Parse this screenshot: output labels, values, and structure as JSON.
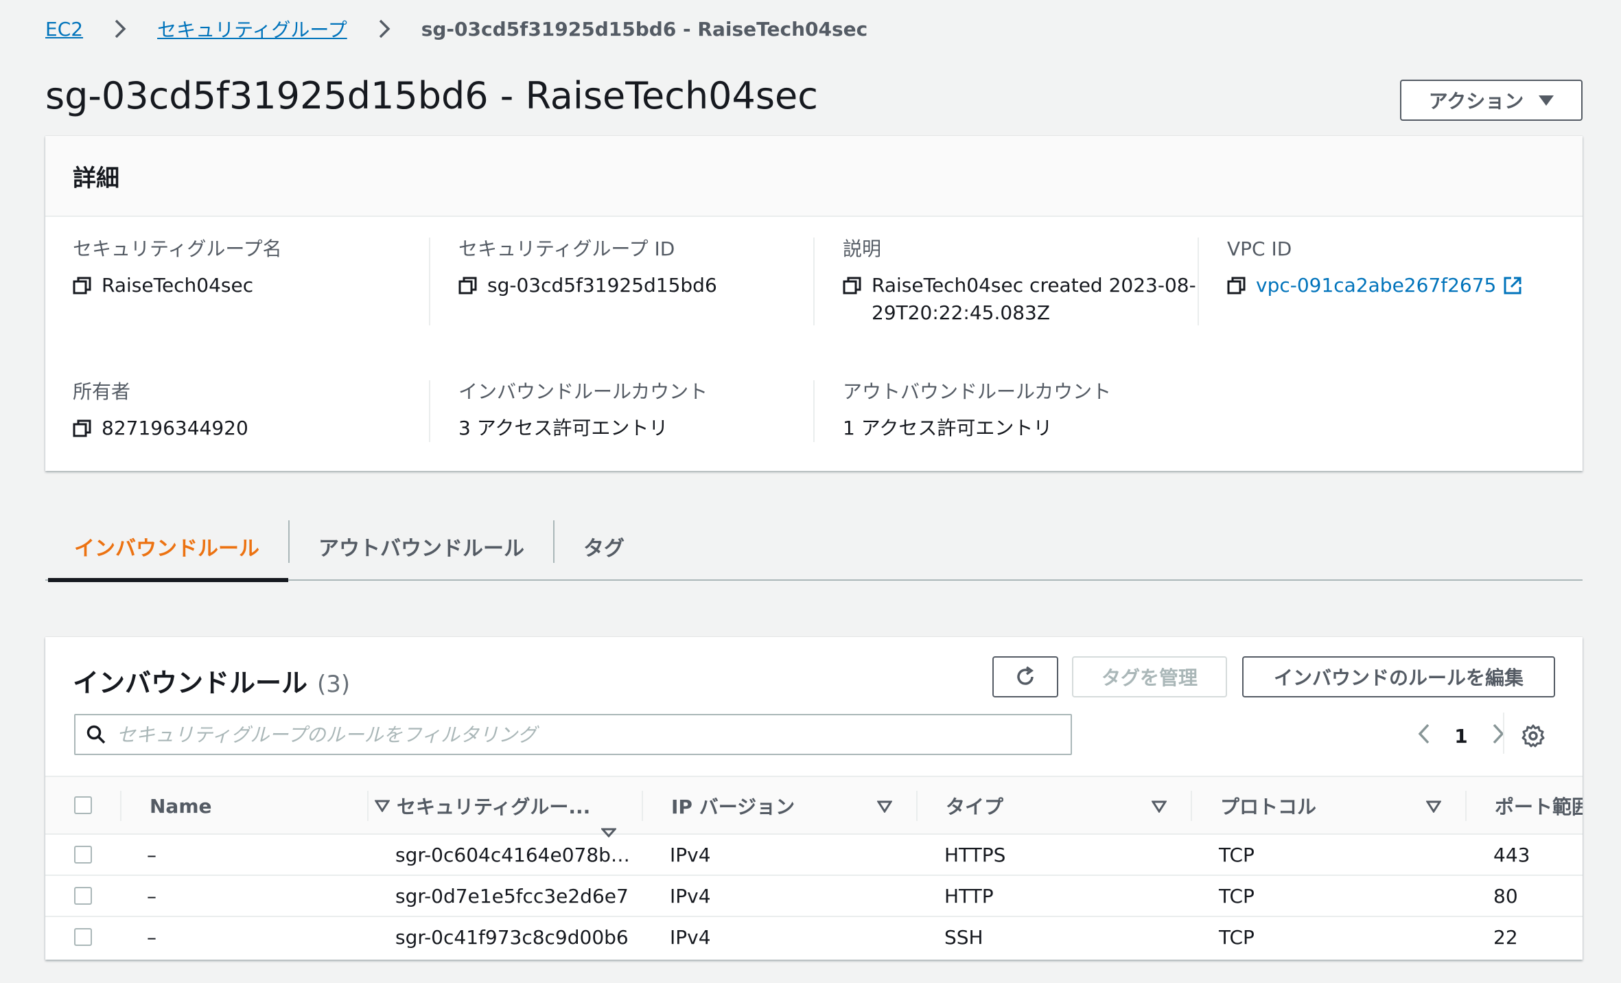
{
  "breadcrumb": {
    "items": [
      {
        "label": "EC2"
      },
      {
        "label": "セキュリティグループ"
      }
    ],
    "current": "sg-03cd5f31925d15bd6 - RaiseTech04sec"
  },
  "page_title": "sg-03cd5f31925d15bd6 - RaiseTech04sec",
  "actions_button": "アクション",
  "details": {
    "header": "詳細",
    "sg_name_label": "セキュリティグループ名",
    "sg_name_value": "RaiseTech04sec",
    "sg_id_label": "セキュリティグループ ID",
    "sg_id_value": "sg-03cd5f31925d15bd6",
    "description_label": "説明",
    "description_value": "RaiseTech04sec created 2023-08-29T20:22:45.083Z",
    "vpc_id_label": "VPC ID",
    "vpc_id_value": "vpc-091ca2abe267f2675",
    "owner_label": "所有者",
    "owner_value": "827196344920",
    "inbound_count_label": "インバウンドルールカウント",
    "inbound_count_value": "3 アクセス許可エントリ",
    "outbound_count_label": "アウトバウンドルールカウント",
    "outbound_count_value": "1 アクセス許可エントリ"
  },
  "tabs": [
    {
      "label": "インバウンドルール",
      "active": true
    },
    {
      "label": "アウトバウンドルール",
      "active": false
    },
    {
      "label": "タグ",
      "active": false
    }
  ],
  "inbound": {
    "title": "インバウンドルール",
    "count": "(3)",
    "manage_tags_button": "タグを管理",
    "edit_button": "インバウンドのルールを編集",
    "search_placeholder": "セキュリティグループのルールをフィルタリング",
    "page_number": "1",
    "columns": [
      "Name",
      "セキュリティグルー...",
      "IP バージョン",
      "タイプ",
      "プロトコル",
      "ポート範囲"
    ],
    "rows": [
      {
        "name": "–",
        "rule_id": "sgr-0c604c4164e078b…",
        "ip_version": "IPv4",
        "type": "HTTPS",
        "protocol": "TCP",
        "port": "443"
      },
      {
        "name": "–",
        "rule_id": "sgr-0d7e1e5fcc3e2d6e7",
        "ip_version": "IPv4",
        "type": "HTTP",
        "protocol": "TCP",
        "port": "80"
      },
      {
        "name": "–",
        "rule_id": "sgr-0c41f973c8c9d00b6",
        "ip_version": "IPv4",
        "type": "SSH",
        "protocol": "TCP",
        "port": "22"
      }
    ]
  },
  "colors": {
    "link": "#0073bb",
    "active_tab": "#ec7211",
    "text": "#16191f",
    "secondary_text": "#545b64"
  }
}
